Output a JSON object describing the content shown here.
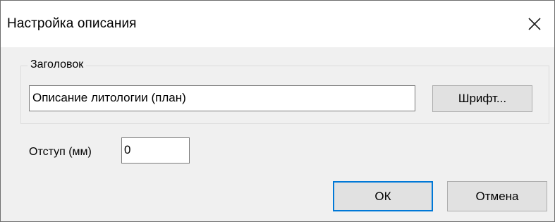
{
  "dialog": {
    "title": "Настройка описания",
    "close_icon": "close-icon"
  },
  "header_group": {
    "legend": "Заголовок",
    "title_value": "Описание литологии (план)",
    "font_button": "Шрифт..."
  },
  "indent": {
    "label": "Отступ (мм)",
    "value": "0"
  },
  "buttons": {
    "ok": "ОК",
    "cancel": "Отмена"
  },
  "colors": {
    "dialog_bg": "#f0f0f0",
    "titlebar_bg": "#ffffff",
    "default_button_border": "#0078d7",
    "button_bg": "#e1e1e1"
  }
}
